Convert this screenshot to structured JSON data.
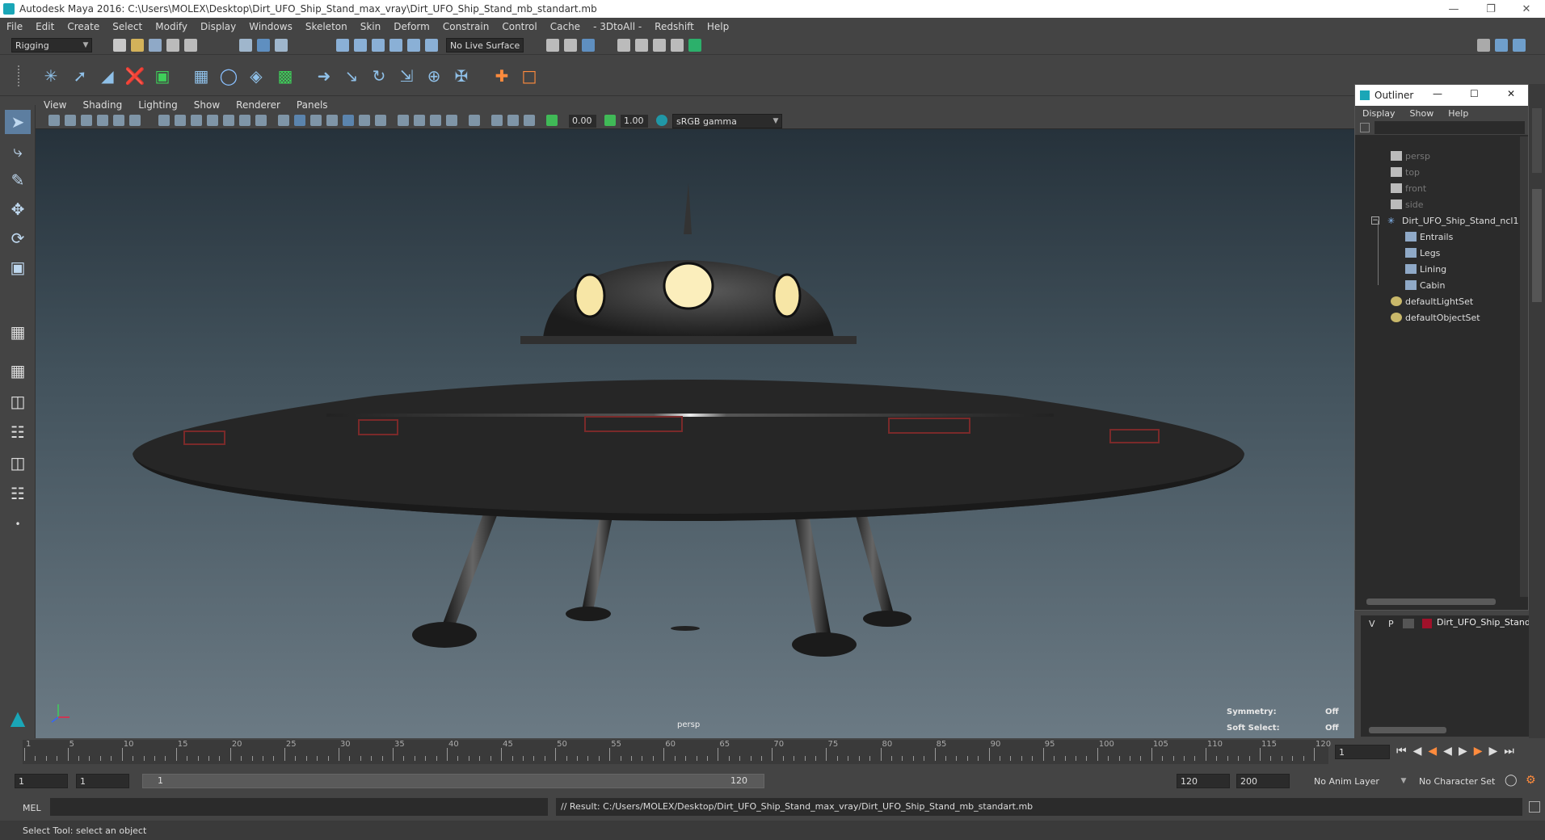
{
  "titlebar": {
    "title": "Autodesk Maya 2016: C:\\Users\\MOLEX\\Desktop\\Dirt_UFO_Ship_Stand_max_vray\\Dirt_UFO_Ship_Stand_mb_standart.mb"
  },
  "menubar": {
    "items": [
      "File",
      "Edit",
      "Create",
      "Select",
      "Modify",
      "Display",
      "Windows",
      "Skeleton",
      "Skin",
      "Deform",
      "Constrain",
      "Control",
      "Cache",
      "- 3DtoAll -",
      "Redshift",
      "Help"
    ]
  },
  "statusline": {
    "mode": "Rigging",
    "live_surface": "No Live Surface"
  },
  "viewport": {
    "menu": [
      "View",
      "Shading",
      "Lighting",
      "Show",
      "Renderer",
      "Panels"
    ],
    "value_a": "0.00",
    "value_b": "1.00",
    "colorspace": "sRGB gamma",
    "camera_label": "persp",
    "hud": {
      "symmetry_label": "Symmetry:",
      "symmetry_value": "Off",
      "softsel_label": "Soft Select:",
      "softsel_value": "Off"
    }
  },
  "outliner": {
    "title": "Outliner",
    "menu": [
      "Display",
      "Show",
      "Help"
    ],
    "items": [
      {
        "label": "persp",
        "type": "camera"
      },
      {
        "label": "top",
        "type": "camera"
      },
      {
        "label": "front",
        "type": "camera"
      },
      {
        "label": "side",
        "type": "camera"
      },
      {
        "label": "Dirt_UFO_Ship_Stand_ncl1",
        "type": "group"
      },
      {
        "label": "Entrails",
        "type": "mesh"
      },
      {
        "label": "Legs",
        "type": "mesh"
      },
      {
        "label": "Lining",
        "type": "mesh"
      },
      {
        "label": "Cabin",
        "type": "mesh"
      },
      {
        "label": "defaultLightSet",
        "type": "set"
      },
      {
        "label": "defaultObjectSet",
        "type": "set"
      }
    ]
  },
  "layer_editor": {
    "visible": "V",
    "playback": "P",
    "layer_name": "Dirt_UFO_Ship_Stand",
    "layer_color": "#a0112a"
  },
  "timeslider": {
    "ticks": [
      "1",
      "5",
      "10",
      "15",
      "20",
      "25",
      "30",
      "35",
      "40",
      "45",
      "50",
      "55",
      "60",
      "65",
      "70",
      "75",
      "80",
      "85",
      "90",
      "95",
      "100",
      "105",
      "110",
      "115",
      "120"
    ],
    "current_frame": "1"
  },
  "range": {
    "start": "1",
    "start_inner": "1",
    "range_start_label": "1",
    "range_end_label": "120",
    "end_inner": "120",
    "end": "200",
    "anim_layer": "No Anim Layer",
    "char_set": "No Character Set"
  },
  "cmdline": {
    "lang": "MEL",
    "result": "// Result: C:/Users/MOLEX/Desktop/Dirt_UFO_Ship_Stand_max_vray/Dirt_UFO_Ship_Stand_mb_standart.mb"
  },
  "helpline": {
    "text": "Select Tool: select an object"
  },
  "colors": {
    "accent": "#1aa6b7",
    "bg": "#444444",
    "panel": "#2b2b2b"
  }
}
